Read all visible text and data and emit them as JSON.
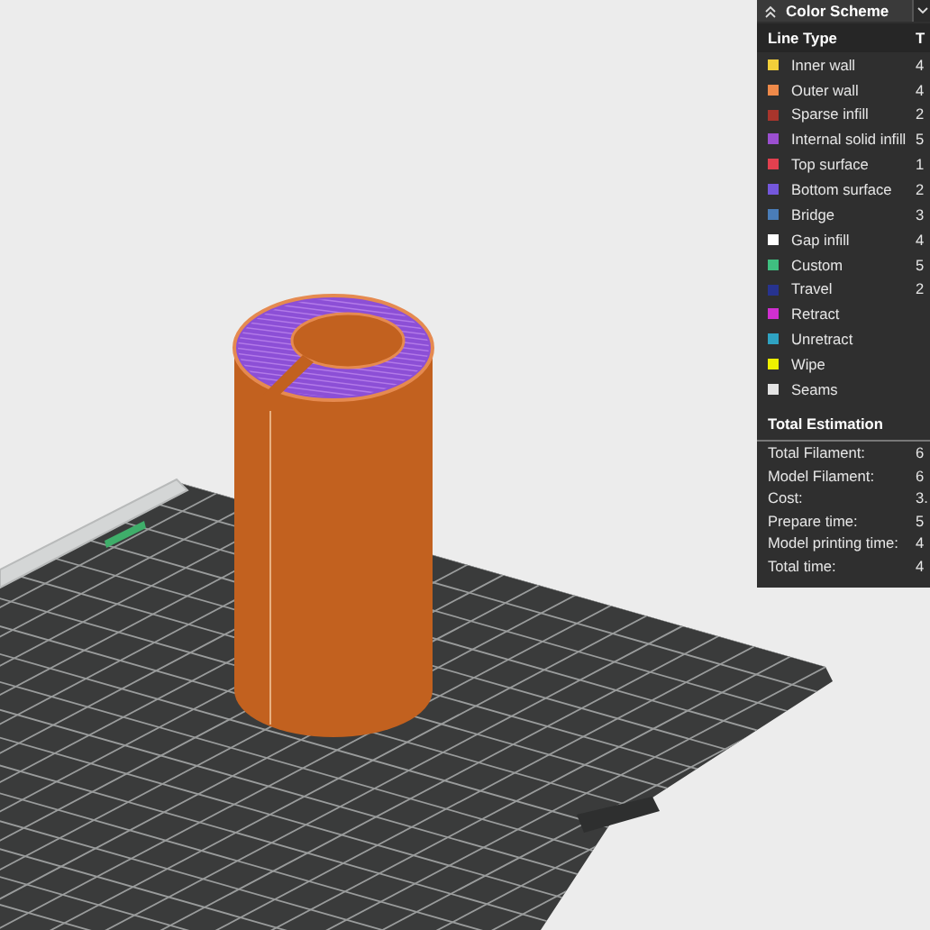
{
  "legend": {
    "title": "Color Scheme",
    "column_1": "Line Type",
    "column_2": "T",
    "line_types": [
      {
        "name": "Inner wall",
        "color": "#f2cf3a",
        "value": "4"
      },
      {
        "name": "Outer wall",
        "color": "#ef8a4a",
        "value": "4"
      },
      {
        "name": "Sparse infill",
        "color": "#a8352c",
        "value": "2"
      },
      {
        "name": "Internal solid infill",
        "color": "#9b4fd0",
        "value": "5"
      },
      {
        "name": "Top surface",
        "color": "#e2404f",
        "value": "1"
      },
      {
        "name": "Bottom surface",
        "color": "#7457dc",
        "value": "2"
      },
      {
        "name": "Bridge",
        "color": "#4a7db8",
        "value": "3"
      },
      {
        "name": "Gap infill",
        "color": "#ffffff",
        "value": "4"
      },
      {
        "name": "Custom",
        "color": "#3fbf80",
        "value": "5"
      },
      {
        "name": "Travel",
        "color": "#27338f",
        "value": "2"
      },
      {
        "name": "Retract",
        "color": "#d02fd0"
      },
      {
        "name": "Unretract",
        "color": "#2fa3c2"
      },
      {
        "name": "Wipe",
        "color": "#eef000"
      },
      {
        "name": "Seams",
        "color": "#e4e4e4"
      }
    ]
  },
  "estimation": {
    "title": "Total Estimation",
    "rows": [
      {
        "label": "Total Filament:",
        "value": "6"
      },
      {
        "label": "Model Filament:",
        "value": "6"
      },
      {
        "label": "Cost:",
        "value": "3."
      },
      {
        "label": "Prepare time:",
        "value": "5"
      },
      {
        "label": "Model printing time:",
        "value": "4"
      },
      {
        "label": "Total time:",
        "value": "4"
      }
    ]
  }
}
